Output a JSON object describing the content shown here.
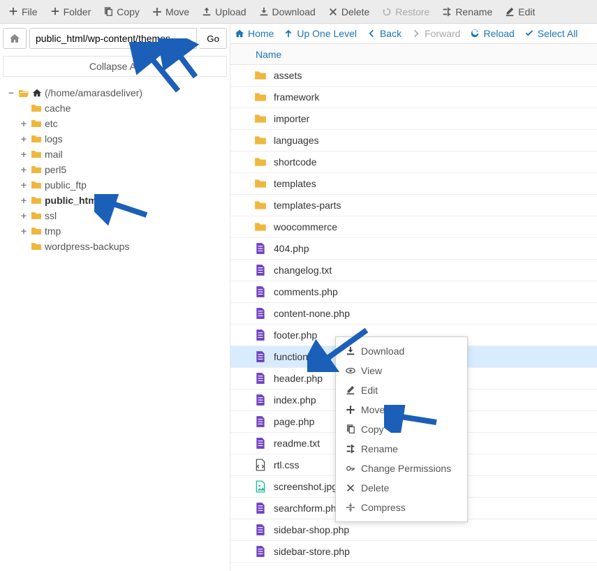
{
  "toolbar": [
    {
      "id": "file",
      "label": "File",
      "icon": "plus"
    },
    {
      "id": "folder",
      "label": "Folder",
      "icon": "plus"
    },
    {
      "id": "copy",
      "label": "Copy",
      "icon": "copy"
    },
    {
      "id": "move",
      "label": "Move",
      "icon": "move"
    },
    {
      "id": "upload",
      "label": "Upload",
      "icon": "upload"
    },
    {
      "id": "download",
      "label": "Download",
      "icon": "download"
    },
    {
      "id": "delete",
      "label": "Delete",
      "icon": "delete"
    },
    {
      "id": "restore",
      "label": "Restore",
      "icon": "restore",
      "disabled": true
    },
    {
      "id": "rename",
      "label": "Rename",
      "icon": "rename"
    },
    {
      "id": "edit",
      "label": "Edit",
      "icon": "edit"
    }
  ],
  "pathbar": {
    "value": "public_html/wp-content/themes",
    "go": "Go"
  },
  "collapse_all": "Collapse All",
  "tree_root": {
    "expander": "−",
    "label": "(/home/amarasdeliver)"
  },
  "tree": [
    {
      "expander": "",
      "label": "cache"
    },
    {
      "expander": "+",
      "label": "etc"
    },
    {
      "expander": "+",
      "label": "logs"
    },
    {
      "expander": "+",
      "label": "mail"
    },
    {
      "expander": "+",
      "label": "perl5"
    },
    {
      "expander": "+",
      "label": "public_ftp"
    },
    {
      "expander": "+",
      "label": "public_html",
      "bold": true
    },
    {
      "expander": "+",
      "label": "ssl"
    },
    {
      "expander": "+",
      "label": "tmp"
    },
    {
      "expander": "",
      "label": "wordpress-backups"
    }
  ],
  "nav": {
    "home": "Home",
    "up": "Up One Level",
    "back": "Back",
    "forward": "Forward",
    "reload": "Reload",
    "select_all": "Select All"
  },
  "column_header": "Name",
  "files": [
    {
      "name": "assets",
      "type": "folder"
    },
    {
      "name": "framework",
      "type": "folder"
    },
    {
      "name": "importer",
      "type": "folder"
    },
    {
      "name": "languages",
      "type": "folder"
    },
    {
      "name": "shortcode",
      "type": "folder"
    },
    {
      "name": "templates",
      "type": "folder"
    },
    {
      "name": "templates-parts",
      "type": "folder"
    },
    {
      "name": "woocommerce",
      "type": "folder"
    },
    {
      "name": "404.php",
      "type": "php"
    },
    {
      "name": "changelog.txt",
      "type": "txt"
    },
    {
      "name": "comments.php",
      "type": "php"
    },
    {
      "name": "content-none.php",
      "type": "php"
    },
    {
      "name": "footer.php",
      "type": "php"
    },
    {
      "name": "functions.php",
      "type": "php",
      "selected": true
    },
    {
      "name": "header.php",
      "type": "php"
    },
    {
      "name": "index.php",
      "type": "php"
    },
    {
      "name": "page.php",
      "type": "php"
    },
    {
      "name": "readme.txt",
      "type": "txt"
    },
    {
      "name": "rtl.css",
      "type": "css"
    },
    {
      "name": "screenshot.jpg",
      "type": "img"
    },
    {
      "name": "searchform.php",
      "type": "php"
    },
    {
      "name": "sidebar-shop.php",
      "type": "php"
    },
    {
      "name": "sidebar-store.php",
      "type": "php"
    }
  ],
  "context_menu": [
    {
      "label": "Download",
      "icon": "download"
    },
    {
      "label": "View",
      "icon": "view"
    },
    {
      "label": "Edit",
      "icon": "edit"
    },
    {
      "label": "Move",
      "icon": "move"
    },
    {
      "label": "Copy",
      "icon": "copy"
    },
    {
      "label": "Rename",
      "icon": "rename"
    },
    {
      "label": "Change Permissions",
      "icon": "key"
    },
    {
      "label": "Delete",
      "icon": "delete"
    },
    {
      "label": "Compress",
      "icon": "compress"
    }
  ]
}
